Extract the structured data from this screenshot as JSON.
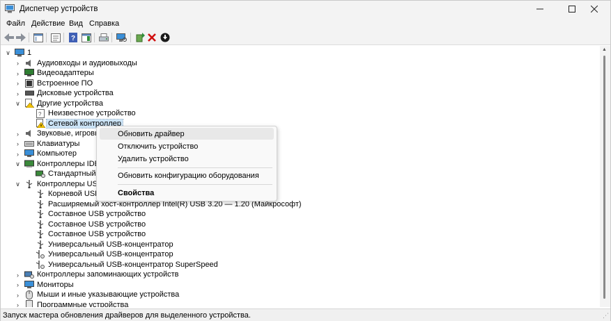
{
  "window": {
    "title": "Диспетчер устройств"
  },
  "menubar": {
    "items": [
      "Файл",
      "Действие",
      "Вид",
      "Справка"
    ]
  },
  "tree": {
    "root_label": "1",
    "rows": [
      "Аудиовходы и аудиовыходы",
      "Видеоадаптеры",
      "Встроенное ПО",
      "Дисковые устройства",
      "Другие устройства",
      "Неизвестное устройство",
      "Сетевой контроллер",
      "Звуковые, игровые",
      "Клавиатуры",
      "Компьютер",
      "Контроллеры IDE A",
      "Стандартный ко",
      "Контроллеры USB",
      "Корневой USB-к",
      "Расширяемый хост-контроллер Intel(R) USB 3.20 — 1.20 (Майкрософт)",
      "Составное USB устройство",
      "Составное USB устройство",
      "Составное USB устройство",
      "Универсальный USB-концентратор",
      "Универсальный USB-концентратор",
      "Универсальный USB-концентратор SuperSpeed",
      "Контроллеры запоминающих устройств",
      "Мониторы",
      "Мыши и иные указывающие устройства",
      "Программные устройства"
    ]
  },
  "context_menu": {
    "update_driver": "Обновить драйвер",
    "disable_device": "Отключить устройство",
    "uninstall_device": "Удалить устройство",
    "scan_hardware": "Обновить конфигурацию оборудования",
    "properties": "Свойства"
  },
  "statusbar": {
    "text": "Запуск мастера обновления драйверов для выделенного устройства."
  },
  "colors": {
    "selection": "#cce4f7",
    "warning": "#f2c200",
    "delete_red": "#d01010",
    "monitor_blue": "#3a8fd8"
  },
  "icons": [
    "app-icon",
    "back-arrow-icon",
    "forward-arrow-icon",
    "properties-icon",
    "help-icon",
    "update-driver-icon",
    "remove-icon",
    "download-icon",
    "warning-icon",
    "usb-icon",
    "monitor-icon"
  ]
}
